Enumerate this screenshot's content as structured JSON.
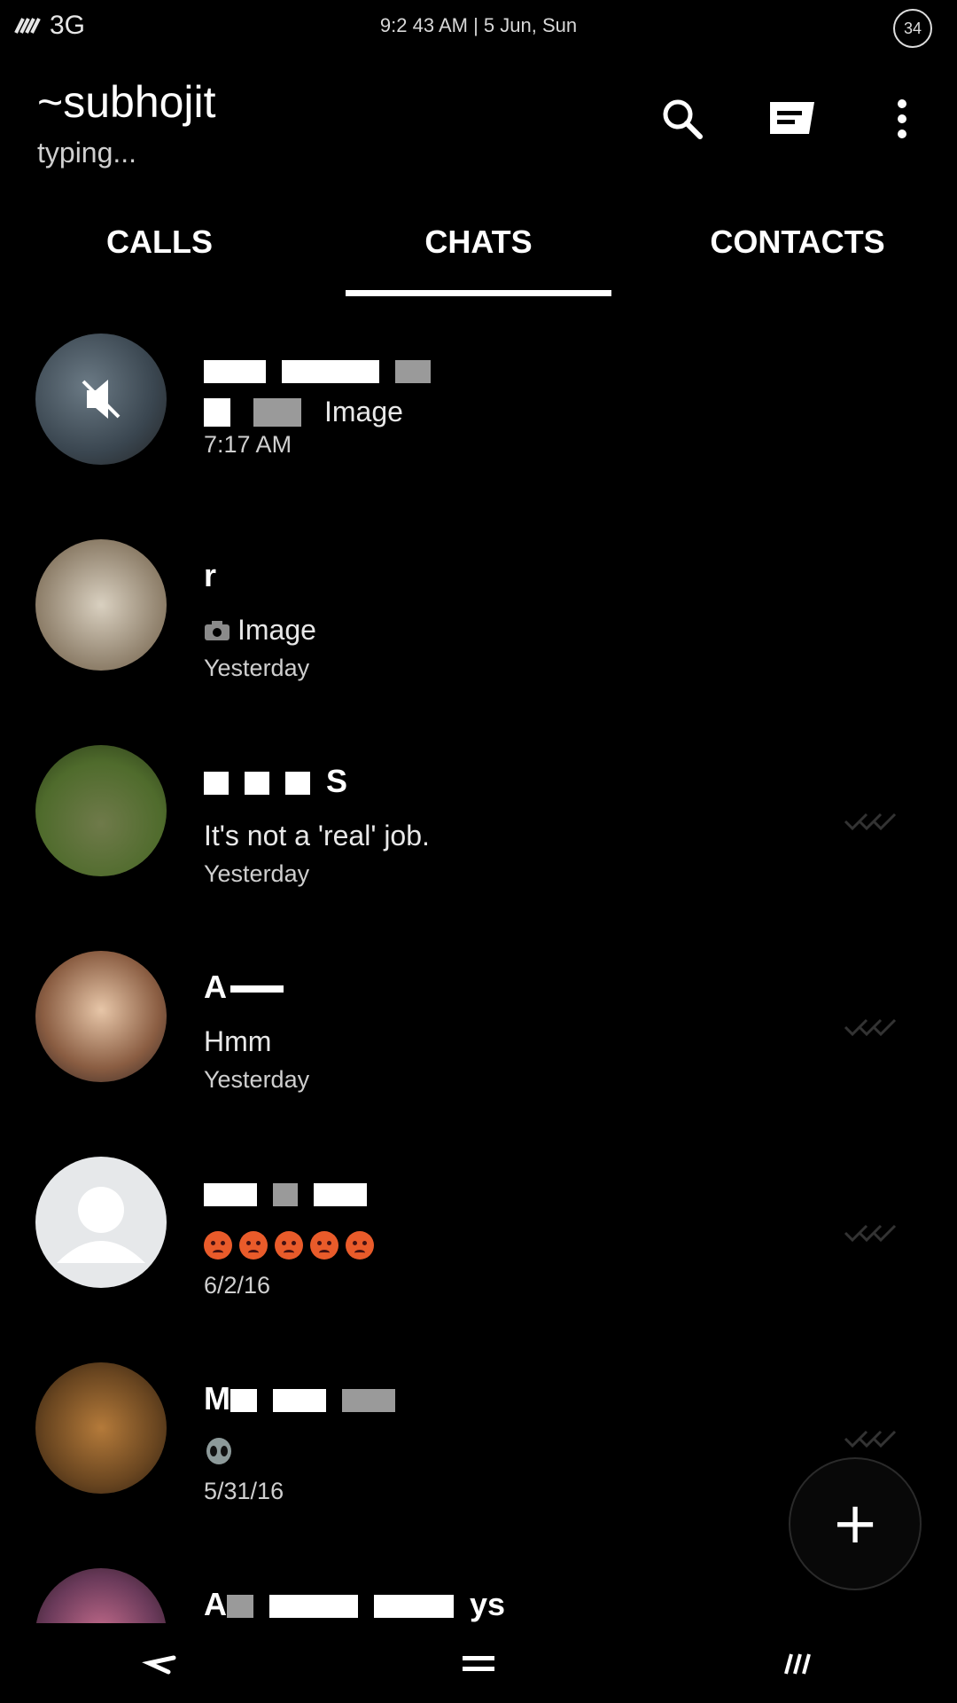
{
  "status_bar": {
    "network": "3G",
    "time": "9:2 43 AM | 5 Jun, Sun",
    "battery": "34"
  },
  "app_bar": {
    "title": "~subhojit",
    "subtitle": "typing...",
    "icons": [
      "search-icon",
      "new-chat-icon",
      "more-vert-icon"
    ]
  },
  "tabs": [
    {
      "label": "CALLS",
      "active": false
    },
    {
      "label": "CHATS",
      "active": true
    },
    {
      "label": "CONTACTS",
      "active": false
    }
  ],
  "chats": [
    {
      "name": "",
      "message": "Image",
      "time": "7:17 AM",
      "muted": true
    },
    {
      "name": "r",
      "message": "Image",
      "time": "Yesterday",
      "icon": "camera-icon"
    },
    {
      "name": "S",
      "message": "It's not a 'real' job.",
      "time": "Yesterday",
      "ticks": true
    },
    {
      "name": "A",
      "message": "Hmm",
      "time": "Yesterday",
      "ticks": true
    },
    {
      "name": "",
      "message": "",
      "time": "6/2/16",
      "ticks": true,
      "emoji": "angry-face-x5"
    },
    {
      "name": "M",
      "message": "",
      "time": "5/31/16",
      "ticks": true,
      "emoji": "alien-face"
    },
    {
      "name": "A",
      "message": "",
      "time": "",
      "name_suffix": "ys"
    }
  ],
  "fab": {
    "label": "+"
  },
  "colors": {
    "background": "#000000",
    "text": "#ffffff",
    "subtext": "#cfcfcf",
    "emoji": "#e95b2a"
  }
}
